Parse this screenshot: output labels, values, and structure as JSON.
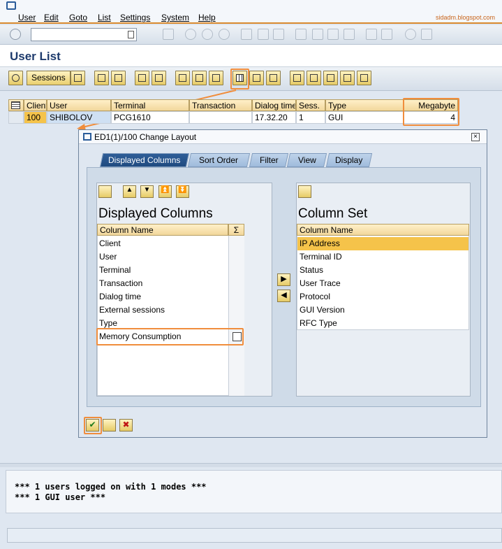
{
  "watermark": "sidadm.blogspot.com",
  "menu": [
    "User",
    "Edit",
    "Goto",
    "List",
    "Settings",
    "System",
    "Help"
  ],
  "page_title": "User List",
  "toolbar": {
    "sessions_label": "Sessions"
  },
  "user_table": {
    "headers": [
      "Client",
      "User",
      "Terminal",
      "Transaction",
      "Dialog time",
      "Sess.",
      "Type",
      "Megabyte"
    ],
    "row": [
      "100",
      "SHIBOLOV",
      "PCG1610",
      "",
      "17.32.20",
      "1",
      "GUI",
      "4"
    ]
  },
  "dialog": {
    "title": "ED1(1)/100 Change Layout",
    "tabs": [
      "Displayed Columns",
      "Sort Order",
      "Filter",
      "View",
      "Display"
    ],
    "left": {
      "heading": "Displayed Columns",
      "column_header": "Column Name",
      "items": [
        "Client",
        "User",
        "Terminal",
        "Transaction",
        "Dialog time",
        "External sessions",
        "Type",
        "Memory Consumption"
      ]
    },
    "right": {
      "heading": "Column Set",
      "column_header": "Column Name",
      "items": [
        "IP Address",
        "Terminal ID",
        "Status",
        "User Trace",
        "Protocol",
        "GUI Version",
        "RFC Type"
      ]
    }
  },
  "status_lines": [
    "*** 1 users logged on with 1 modes ***",
    "*** 1 GUI user ***"
  ],
  "colors": {
    "highlight": "#f08d3c",
    "selected_row": "#f5c34a",
    "tab_active": "#1f4a80",
    "title": "#1e3b6d"
  }
}
